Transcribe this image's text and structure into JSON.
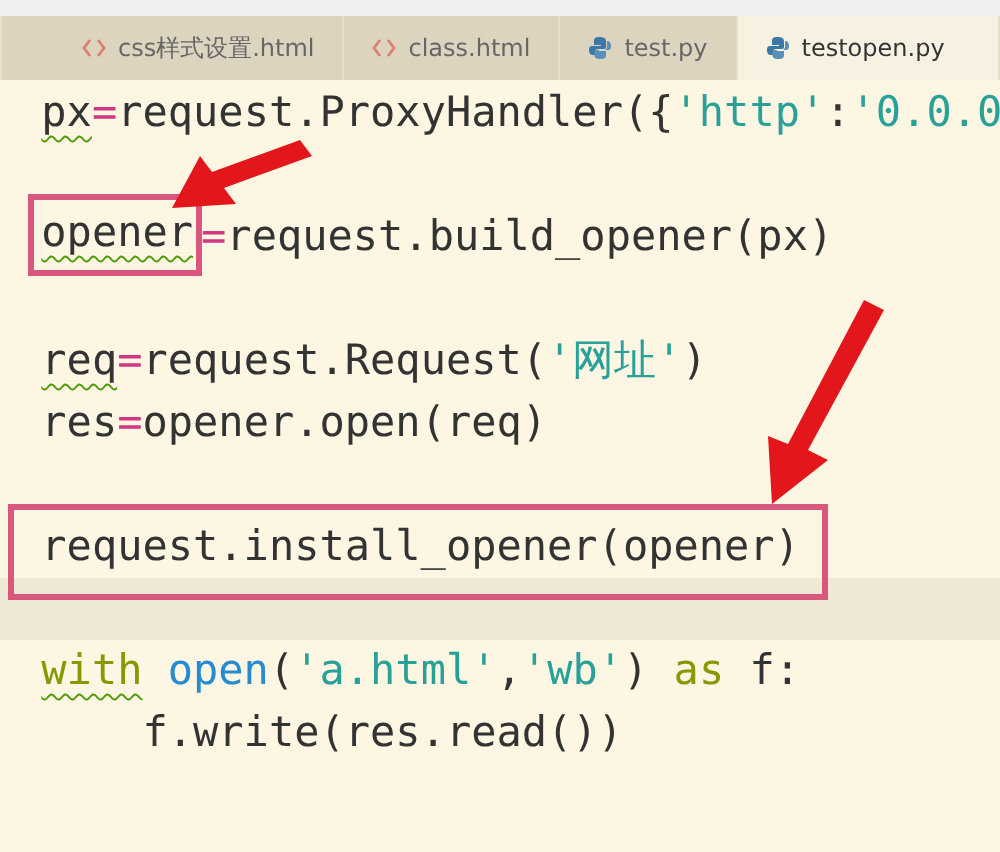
{
  "tabs": [
    {
      "label": "css样式设置.html",
      "kind": "html",
      "selected": false
    },
    {
      "label": "class.html",
      "kind": "html",
      "selected": false
    },
    {
      "label": "test.py",
      "kind": "python",
      "selected": false
    },
    {
      "label": "testopen.py",
      "kind": "python",
      "selected": true
    }
  ],
  "code_lines": [
    {
      "kind": "code",
      "current": false,
      "boxed": false,
      "tokens": [
        {
          "text": "px",
          "kind": "plain",
          "warn": true,
          "boxed": false
        },
        {
          "text": "=",
          "kind": "operator",
          "warn": false,
          "boxed": false
        },
        {
          "text": "request.ProxyHandler({",
          "kind": "plain",
          "warn": false,
          "boxed": false
        },
        {
          "text": "'http'",
          "kind": "string",
          "warn": false,
          "boxed": false
        },
        {
          "text": ":",
          "kind": "plain",
          "warn": false,
          "boxed": false
        },
        {
          "text": "'0.0.0",
          "kind": "string",
          "warn": false,
          "boxed": false
        }
      ]
    },
    {
      "kind": "blank",
      "current": false,
      "boxed": false
    },
    {
      "kind": "code",
      "current": false,
      "boxed": false,
      "tokens": [
        {
          "text": "opener",
          "kind": "plain",
          "warn": true,
          "boxed": true
        },
        {
          "text": "=",
          "kind": "operator",
          "warn": false,
          "boxed": false
        },
        {
          "text": "request.build_opener(px)",
          "kind": "plain",
          "warn": false,
          "boxed": false
        }
      ]
    },
    {
      "kind": "blank",
      "current": false,
      "boxed": false
    },
    {
      "kind": "code",
      "current": false,
      "boxed": false,
      "tokens": [
        {
          "text": "req",
          "kind": "plain",
          "warn": true,
          "boxed": false
        },
        {
          "text": "=",
          "kind": "operator",
          "warn": false,
          "boxed": false
        },
        {
          "text": "request.Request(",
          "kind": "plain",
          "warn": false,
          "boxed": false
        },
        {
          "text": "'网址'",
          "kind": "string",
          "warn": false,
          "boxed": false
        },
        {
          "text": ")",
          "kind": "plain",
          "warn": false,
          "boxed": false
        }
      ]
    },
    {
      "kind": "code",
      "current": false,
      "boxed": false,
      "tokens": [
        {
          "text": "res",
          "kind": "plain",
          "warn": false,
          "boxed": false
        },
        {
          "text": "=",
          "kind": "operator",
          "warn": false,
          "boxed": false
        },
        {
          "text": "opener.open(req)",
          "kind": "plain",
          "warn": false,
          "boxed": false
        }
      ]
    },
    {
      "kind": "blank",
      "current": false,
      "boxed": false
    },
    {
      "kind": "code",
      "current": false,
      "boxed": true,
      "tokens": [
        {
          "text": "request.install_opener(opener)",
          "kind": "plain",
          "warn": false,
          "boxed": false
        }
      ]
    },
    {
      "kind": "blank",
      "current": true,
      "boxed": false
    },
    {
      "kind": "code",
      "current": false,
      "boxed": false,
      "tokens": [
        {
          "text": "with",
          "kind": "keyword",
          "warn": true,
          "boxed": false
        },
        {
          "text": " open",
          "kind": "builtin",
          "warn": false,
          "boxed": false
        },
        {
          "text": "(",
          "kind": "plain",
          "warn": false,
          "boxed": false
        },
        {
          "text": "'a.html'",
          "kind": "string",
          "warn": false,
          "boxed": false
        },
        {
          "text": ",",
          "kind": "plain",
          "warn": false,
          "boxed": false
        },
        {
          "text": "'wb'",
          "kind": "string",
          "warn": false,
          "boxed": false
        },
        {
          "text": ") ",
          "kind": "plain",
          "warn": false,
          "boxed": false
        },
        {
          "text": "as",
          "kind": "keyword",
          "warn": false,
          "boxed": false
        },
        {
          "text": " f:",
          "kind": "plain",
          "warn": false,
          "boxed": false
        }
      ]
    },
    {
      "kind": "code",
      "current": false,
      "boxed": false,
      "tokens": [
        {
          "text": "    f.write(res.read())",
          "kind": "plain",
          "warn": false,
          "boxed": false
        }
      ]
    }
  ]
}
